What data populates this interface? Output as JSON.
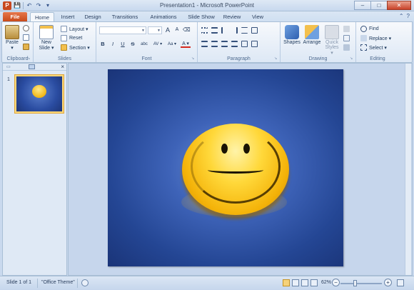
{
  "window": {
    "title": "Presentation1 - Microsoft PowerPoint"
  },
  "qat": {
    "app_icon": "P",
    "save": "💾",
    "undo": "↶",
    "redo": "↷",
    "customize": "▾"
  },
  "window_controls": {
    "minimize": "–",
    "maximize": "□",
    "close": "✕"
  },
  "tabs": [
    "File",
    "Home",
    "Insert",
    "Design",
    "Transitions",
    "Animations",
    "Slide Show",
    "Review",
    "View"
  ],
  "tab_extras": {
    "minimize_ribbon": "⌃",
    "help": "?"
  },
  "ribbon": {
    "clipboard": {
      "label": "Clipboard",
      "paste": "Paste",
      "paste_arrow": "▾"
    },
    "slides": {
      "label": "Slides",
      "new_slide": "New",
      "new_slide_2": "Slide ▾",
      "layout": "Layout ▾",
      "reset": "Reset",
      "section": "Section ▾"
    },
    "font": {
      "label": "Font",
      "bold": "B",
      "italic": "I",
      "underline": "U",
      "strike": "S",
      "shadow": "abc",
      "spacing": "AV ▾",
      "case": "Aa ▾",
      "color": "A ▾",
      "grow": "A",
      "shrink": "A",
      "clear": "⌫"
    },
    "paragraph": {
      "label": "Paragraph"
    },
    "drawing": {
      "label": "Drawing",
      "shapes": "Shapes",
      "arrange": "Arrange",
      "quick_styles": "Quick",
      "quick_styles_2": "Styles ▾"
    },
    "editing": {
      "label": "Editing",
      "find": "Find",
      "replace": "Replace ▾",
      "select": "Select ▾"
    }
  },
  "slides_panel": {
    "slide_number": "1",
    "close": "×"
  },
  "status": {
    "slide": "Slide 1 of 1",
    "theme": "\"Office Theme\"",
    "zoom": "62%",
    "zoom_minus": "−",
    "zoom_plus": "+"
  },
  "colors": {
    "file_tab": "#c84a1a",
    "slide_bg": "#2a4ca1",
    "smiley": "#f4b309"
  }
}
